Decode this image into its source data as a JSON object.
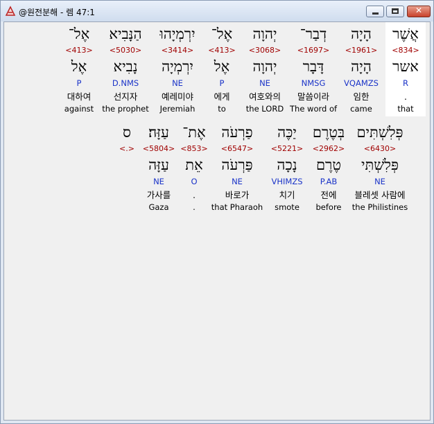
{
  "window": {
    "title": "@원전분해 - 렘 47:1",
    "minimize_label": "",
    "maximize_label": "",
    "close_label": "✕"
  },
  "rows": [
    {
      "words": [
        {
          "heb": "אֲשֶׁר",
          "strong": "<834>",
          "lemma": "אשר",
          "morph": "R",
          "kor": ".",
          "eng": "that",
          "highlight": true
        },
        {
          "heb": "הָיָה",
          "strong": "<1961>",
          "lemma": "הָיָה",
          "morph": "VQAMZS",
          "kor": "임한",
          "eng": "came",
          "highlight": false
        },
        {
          "heb": "דְבַר־",
          "strong": "<1697>",
          "lemma": "דָּבָר",
          "morph": "NMSG",
          "kor": "말씀이라",
          "eng": "The word of",
          "highlight": false
        },
        {
          "heb": "יְהוָה",
          "strong": "<3068>",
          "lemma": "יְהוָה",
          "morph": "NE",
          "kor": "여호와의",
          "eng": "the LORD",
          "highlight": false
        },
        {
          "heb": "אֶל־",
          "strong": "<413>",
          "lemma": "אֶל",
          "morph": "P",
          "kor": "에게",
          "eng": "to",
          "highlight": false
        },
        {
          "heb": "יִרְמְיָהוּ",
          "strong": "<3414>",
          "lemma": "יִרְמְיָה",
          "morph": "NE",
          "kor": "예레미야",
          "eng": "Jeremiah",
          "highlight": false
        },
        {
          "heb": "הַנָּבִיא",
          "strong": "<5030>",
          "lemma": "נָבִיא",
          "morph": "D.NMS",
          "kor": "선지자",
          "eng": "the prophet",
          "highlight": false
        },
        {
          "heb": "אֶל־",
          "strong": "<413>",
          "lemma": "אֶל",
          "morph": "P",
          "kor": "대하여",
          "eng": "against",
          "highlight": false
        }
      ]
    },
    {
      "words": [
        {
          "heb": "פְּלִשְׁתִּים",
          "strong": "<6430>",
          "lemma": "פְּלִשְׁתִּי",
          "morph": "NE",
          "kor": "블레셋 사람에",
          "eng": "the Philistines",
          "highlight": false
        },
        {
          "heb": "בְּטֶרֶם",
          "strong": "<2962>",
          "lemma": "טֶרֶם",
          "morph": "P.AB",
          "kor": "전에",
          "eng": "before",
          "highlight": false
        },
        {
          "heb": "יַכֶּה",
          "strong": "<5221>",
          "lemma": "נָכָה",
          "morph": "VHIMZS",
          "kor": "치기",
          "eng": "smote",
          "highlight": false
        },
        {
          "heb": "פַרְעֹה",
          "strong": "<6547>",
          "lemma": "פַּרְעֹה",
          "morph": "NE",
          "kor": "바로가",
          "eng": "that Pharaoh",
          "highlight": false
        },
        {
          "heb": "אֶת־",
          "strong": "<853>",
          "lemma": "אֵת",
          "morph": "O",
          "kor": ".",
          "eng": ".",
          "highlight": false
        },
        {
          "heb": "עַזָּה׃",
          "strong": "<5804>",
          "lemma": "עַזָּה",
          "morph": "NE",
          "kor": "가사를",
          "eng": "Gaza",
          "highlight": false
        },
        {
          "heb": "ס",
          "strong": "<.>",
          "lemma": "",
          "morph": "",
          "kor": "",
          "eng": "",
          "highlight": false
        }
      ]
    }
  ]
}
